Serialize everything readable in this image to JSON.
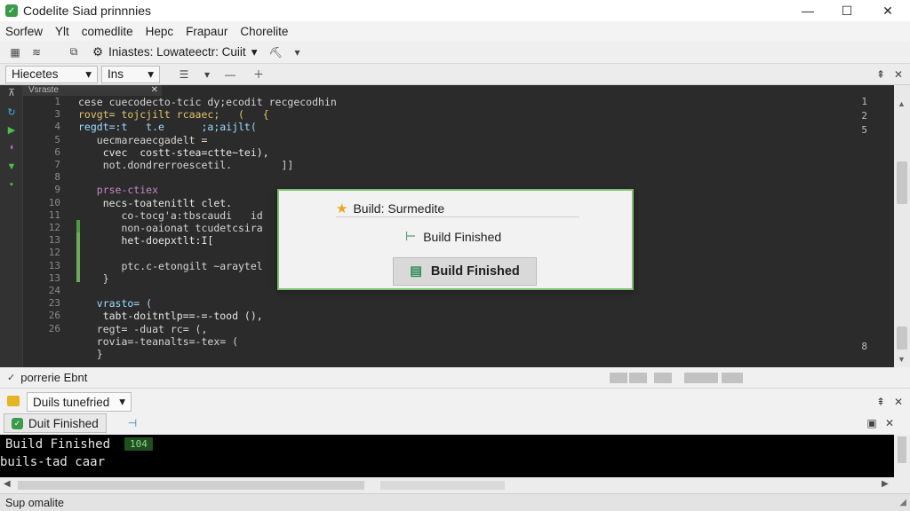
{
  "window": {
    "title": "Codelite Siad prinnnies"
  },
  "menu": [
    "Sorfew",
    "Ylt",
    "comedlite",
    "Hepc",
    "Frapaur",
    "Chorelite"
  ],
  "toolbar": {
    "combo_label": "Iniastes: Lowateectr: Cuiit"
  },
  "tabbar": {
    "combo1": "Hiecetes",
    "combo2": "Ins"
  },
  "panel": {
    "header": "Vsraste"
  },
  "editor": {
    "line_numbers": [
      "1",
      "3",
      "4",
      "5",
      "6",
      "7",
      "8",
      "9",
      "10",
      "11",
      "12",
      "13",
      "12",
      "13",
      "13",
      "24",
      "23",
      "26",
      "26"
    ],
    "lines": [
      "cese cuecodecto-tcic dy;ecodit recgecodhin",
      "rovgt= tojcjilt rcaaec;   (   {",
      "regdt=:t   t.e      ;a;aijlt(",
      "   uecmareaecgadelt =",
      "    cvec  costt-stea=ctte~tei),",
      "    not.dondrerroescetil.        ]]",
      "",
      "   prse-ctiex",
      "    necs-toatenitlt clet.",
      "       co-tocg'a:tbscaudi   id",
      "       non-oaionat tcudetcsira",
      "       het-doepxtlt:I[",
      "",
      "       ptc.c-etongilt ~araytel",
      "    }",
      "",
      "   vrasto= (",
      "    tabt-doitntlp==-=-tood (),",
      "   regt= -duat rc= (,"
    ],
    "lines_tail": [
      "   rovia=-teanalts=-tex= (",
      "   }"
    ],
    "right_numbers": [
      "1",
      "2",
      "5",
      "8"
    ]
  },
  "dialog": {
    "title": "Build: Surmedite",
    "line": "Build Finished",
    "button": "Build Finished"
  },
  "midbar": {
    "label": "porrerie Ebnt"
  },
  "bottom": {
    "combo": "Duils tunefried",
    "tab_label": "Duit Finished"
  },
  "console": {
    "line1": "Build Finished",
    "badge": "104",
    "line2": "buils-tad caar"
  },
  "status": {
    "text": "Sup omalite"
  },
  "colors": {
    "accent": "#4c9a3f",
    "editor_bg": "#2b2b2b"
  }
}
